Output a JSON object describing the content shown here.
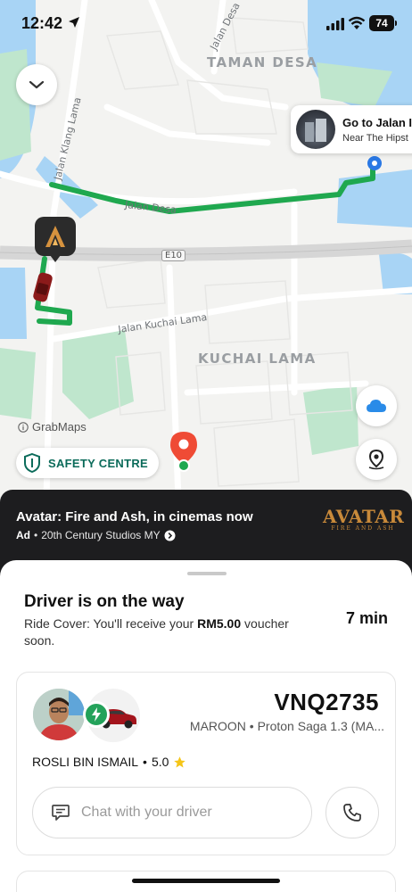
{
  "status_bar": {
    "time": "12:42",
    "battery": "74"
  },
  "map": {
    "areas": [
      "TAMAN DESA",
      "KUCHAI LAMA"
    ],
    "roads": {
      "klang_lama": "Jalan Klang Lama",
      "desa": "Jalan Desa",
      "kuchai_lama": "Jalan Kuchai Lama",
      "highway": "E10",
      "top": "Jalan Desa"
    },
    "destination": {
      "title": "Go to Jalan I",
      "subtitle": "Near The Hipst"
    },
    "attribution": "GrabMaps",
    "safety_label": "SAFETY CENTRE",
    "colors": {
      "route": "#1fa84f",
      "pin": "#ef4b35"
    },
    "icons": {
      "collapse": "chevron-down-icon",
      "weather": "cloud-icon",
      "locate": "locate-icon",
      "safety": "shield-icon"
    }
  },
  "ad": {
    "title": "Avatar: Fire and Ash, in cinemas now",
    "badge": "Ad",
    "sponsor": "20th Century Studios MY",
    "logo_main": "AVATAR",
    "logo_sub": "FIRE AND ASH"
  },
  "trip": {
    "status": "Driver is on the way",
    "ride_cover_prefix": "Ride Cover: You'll receive your ",
    "ride_cover_amount": "RM5.00",
    "ride_cover_suffix": " voucher soon.",
    "eta": "7 min"
  },
  "driver": {
    "plate": "VNQ2735",
    "car": "MAROON • Proton Saga 1.3 (MA...",
    "name": "ROSLI BIN ISMAIL",
    "rating": "5.0",
    "chat_placeholder": "Chat with your driver"
  }
}
